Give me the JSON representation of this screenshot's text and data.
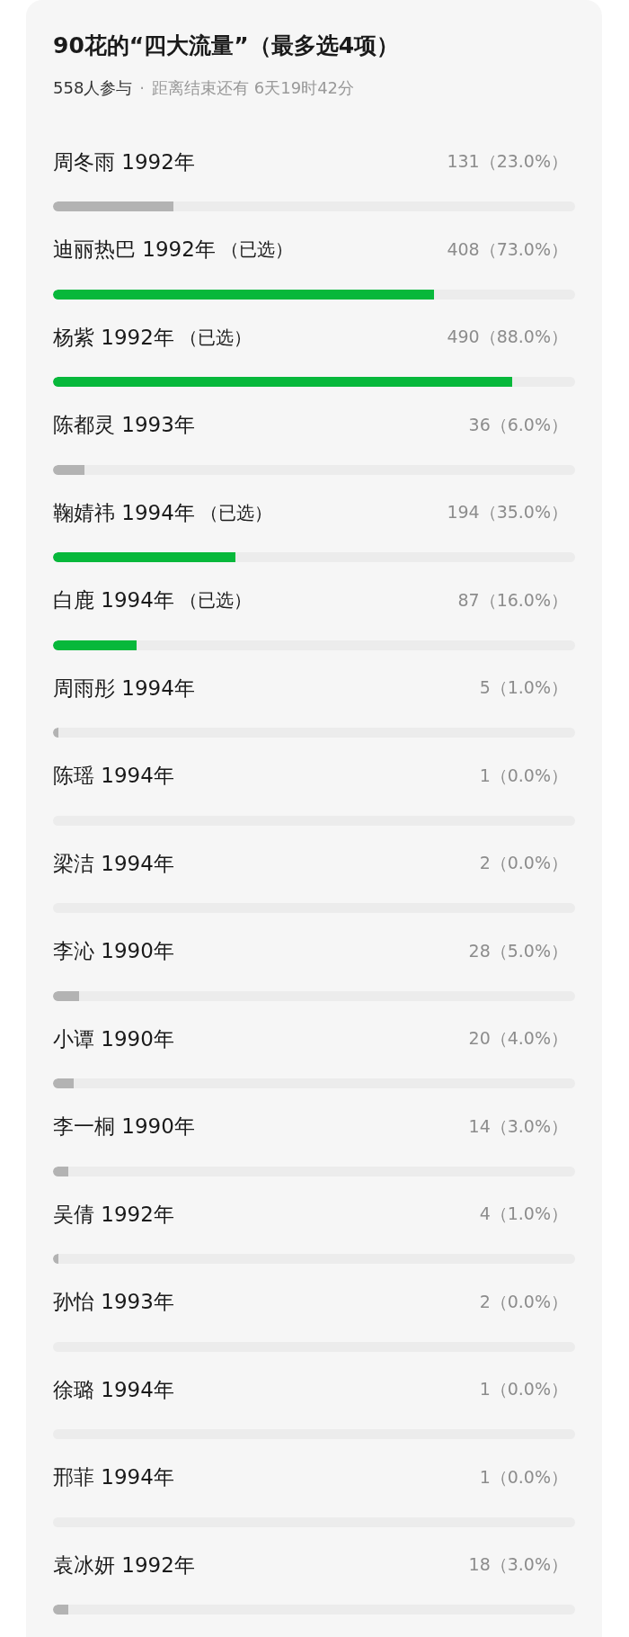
{
  "poll": {
    "title": "90花的“四大流量”（最多选4项）",
    "participants": "558人参与",
    "separator": "·",
    "deadline": "距离结束还有 6天19时42分",
    "options": [
      {
        "label": "周冬雨 1992年",
        "selected": false,
        "result": "131（23.0%）",
        "level": 0.23
      },
      {
        "label": "迪丽热巴 1992年",
        "selected": true,
        "tag": "（已选）",
        "result": "408（73.0%）",
        "level": 0.73
      },
      {
        "label": "杨紫 1992年",
        "selected": true,
        "tag": "（已选）",
        "result": "490（88.0%）",
        "level": 0.88
      },
      {
        "label": "陈都灵 1993年",
        "selected": false,
        "result": "36（6.0%）",
        "level": 0.06
      },
      {
        "label": "鞠婧祎 1994年",
        "selected": true,
        "tag": "（已选）",
        "result": "194（35.0%）",
        "level": 0.35
      },
      {
        "label": "白鹿 1994年",
        "selected": true,
        "tag": "（已选）",
        "result": "87（16.0%）",
        "level": 0.16
      },
      {
        "label": "周雨彤 1994年",
        "selected": false,
        "result": "5（1.0%）",
        "level": 0.01
      },
      {
        "label": "陈瑶 1994年",
        "result": "1（0.0%）"
      },
      {
        "label": "梁洁 1994年",
        "result": "2（0.0%）"
      },
      {
        "label": "李沁 1990年",
        "selected": false,
        "result": "28（5.0%）",
        "level": 0.05
      },
      {
        "label": "小谭 1990年",
        "selected": false,
        "result": "20（4.0%）",
        "level": 0.04
      },
      {
        "label": "李一桐 1990年",
        "selected": false,
        "result": "14（3.0%）",
        "level": 0.03
      },
      {
        "label": "吴倩 1992年",
        "selected": false,
        "result": "4（1.0%）",
        "level": 0.01
      },
      {
        "label": "孙怡 1993年",
        "result": "2（0.0%）"
      },
      {
        "label": "徐璐 1994年",
        "result": "1（0.0%）"
      },
      {
        "label": "邢菲 1994年",
        "result": "1（0.0%）"
      },
      {
        "label": "袁冰妍 1992年",
        "selected": false,
        "result": "18（3.0%）",
        "level": 0.03
      }
    ]
  }
}
